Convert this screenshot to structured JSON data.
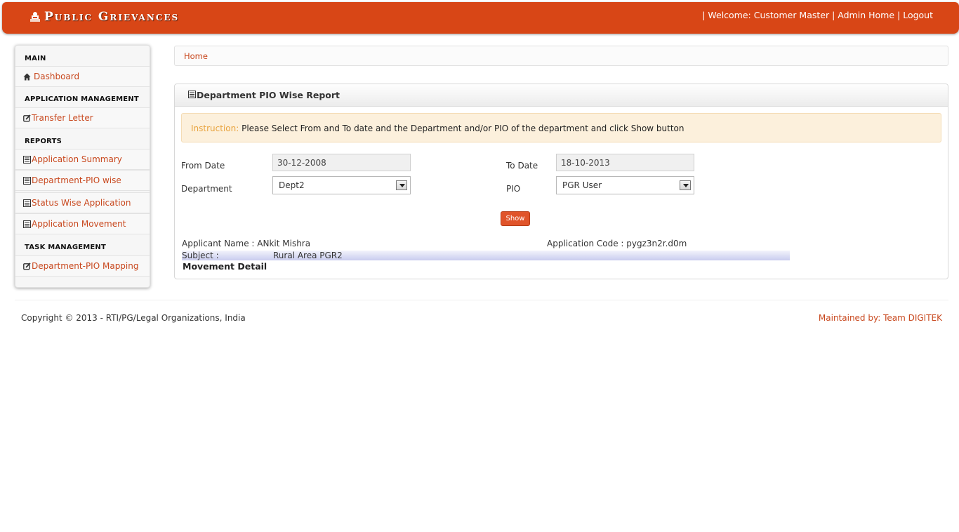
{
  "header": {
    "brand": "Public Grievances",
    "welcome": "| Welcome: Customer Master",
    "admin_home": "| Admin Home",
    "logout": "| Logout"
  },
  "sidebar": {
    "main_heading": "MAIN",
    "dashboard": "Dashboard",
    "app_mgmt_heading": "APPLICATION MANAGEMENT",
    "transfer_letter": "Transfer Letter",
    "reports_heading": "REPORTS",
    "application_summary": "Application Summary",
    "department_pio_wise": "Department-PIO wise",
    "status_wise_application": "Status Wise Application",
    "application_movement": "Application Movement",
    "task_mgmt_heading": "TASK MANAGEMENT",
    "department_pio_mapping": "Department-PIO Mapping"
  },
  "breadcrumb": {
    "home": "Home"
  },
  "panel": {
    "title": "Department PIO Wise Report",
    "instruction_label": "Instruction:",
    "instruction_text": " Please Select From and To date and the Department and/or PIO of the department and click Show button"
  },
  "form": {
    "from_date_label": "From Date",
    "from_date_value": "30-12-2008",
    "to_date_label": "To Date",
    "to_date_value": "18-10-2013",
    "department_label": "Department",
    "department_value": "Dept2",
    "pio_label": "PIO",
    "pio_value": "PGR User",
    "show_button": "Show"
  },
  "result": {
    "applicant_name": "Applicant Name : ANkit Mishra",
    "application_code": "Application Code : pygz3n2r.d0m",
    "subject_label": "Subject :",
    "subject_value": "Rural Area PGR2",
    "movement_detail": "Movement Detail"
  },
  "footer": {
    "copyright": "Copyright © 2013 - RTI/PG/Legal Organizations, India",
    "maintained_by": "Maintained by: Team DIGITEK"
  },
  "colors": {
    "brand": "#d84616",
    "link": "#c8471d",
    "instruction_bg": "#fcf0dc",
    "button": "#e0542a"
  }
}
